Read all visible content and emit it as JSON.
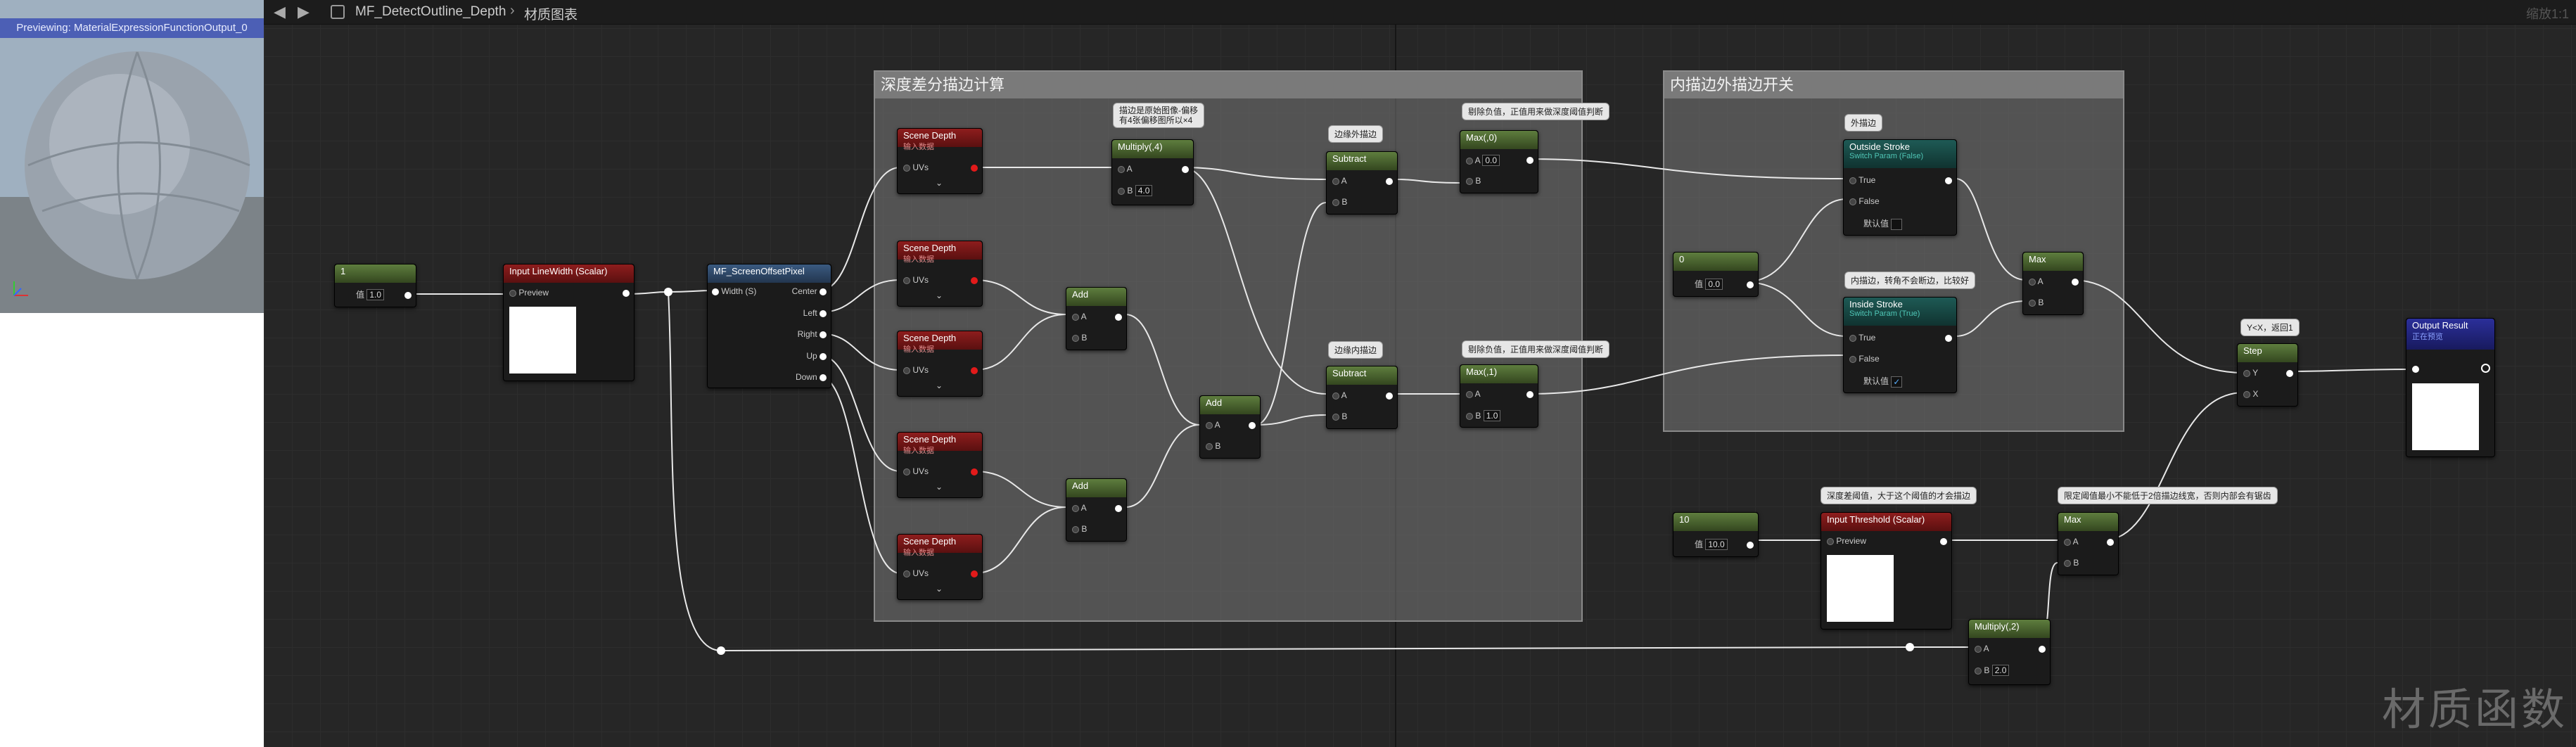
{
  "preview": {
    "title": "Previewing: MaterialExpressionFunctionOutput_0"
  },
  "toolbar": {
    "back": "◀",
    "forward": "▶",
    "asset": "MF_DetectOutline_Depth",
    "separator": "›",
    "tab": "材质图表",
    "zoom": "缩放1:1"
  },
  "watermark": "材质函数",
  "comments": {
    "depth": "深度差分描边计算",
    "switch": "内描边外描边开关"
  },
  "nodes": {
    "const1": {
      "value": "1",
      "label": "值",
      "box": "1.0"
    },
    "linewidth": {
      "title": "Input LineWidth (Scalar)",
      "pin": "Preview"
    },
    "screenoffset": {
      "title": "MF_ScreenOffsetPixel",
      "in": "Width (S)",
      "outs": [
        "Center",
        "Left",
        "Right",
        "Up",
        "Down"
      ]
    },
    "scenedepth": {
      "title": "Scene Depth",
      "sub": "输入数据",
      "pin": "UVs"
    },
    "add": {
      "title": "Add",
      "a": "A",
      "b": "B"
    },
    "multiply4": {
      "title": "Multiply(,4)",
      "a": "A",
      "b": "B",
      "bval": "4.0"
    },
    "subtract": {
      "title": "Subtract",
      "a": "A",
      "b": "B"
    },
    "max0": {
      "title": "Max(,0)",
      "a": "A",
      "b": "B",
      "bval": "0.0"
    },
    "max1": {
      "title": "Max(,1)",
      "a": "A",
      "b": "B",
      "bval": "1.0"
    },
    "const0": {
      "value": "0",
      "label": "值",
      "box": "0.0"
    },
    "outside": {
      "title": "Outside Stroke",
      "sub": "Switch Param (False)",
      "t": "True",
      "f": "False",
      "def": "默认值"
    },
    "inside": {
      "title": "Inside Stroke",
      "sub": "Switch Param (True)",
      "t": "True",
      "f": "False",
      "def": "默认值",
      "check": "✓"
    },
    "maxmid": {
      "title": "Max",
      "a": "A",
      "b": "B"
    },
    "step": {
      "title": "Step",
      "y": "Y",
      "x": "X"
    },
    "output": {
      "title": "Output Result",
      "sub": "正在预览"
    },
    "const10": {
      "value": "10",
      "label": "值",
      "box": "10.0"
    },
    "threshold": {
      "title": "Input Threshold (Scalar)",
      "pin": "Preview"
    },
    "maxthr": {
      "title": "Max",
      "a": "A",
      "b": "B"
    },
    "multiply2": {
      "title": "Multiply(,2)",
      "a": "A",
      "b": "B",
      "bval": "2.0"
    }
  },
  "bubbles": {
    "mult": "描边是原始图像-偏移\n有4张偏移图所以×4",
    "outer": "边缘外描边",
    "inner": "边缘内描边",
    "rm1": "剔除负值，正值用来做深度阈值判断",
    "rm2": "剔除负值，正值用来做深度阈值判断",
    "outside": "外描边",
    "inside": "内描边，转角不会断边，比较好",
    "step": "Y<X，返回1",
    "thr": "深度差阈值，大于这个阈值的才会描边",
    "thr2": "限定阈值最小不能低于2倍描边线宽，否则内部会有锯齿"
  },
  "colors": {
    "accent": "#4c5fb5",
    "pin_red": "#e21a1a",
    "wire": "#e8e8e8"
  }
}
